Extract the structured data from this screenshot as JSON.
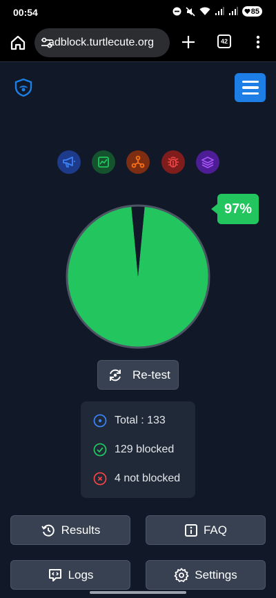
{
  "status_bar": {
    "time": "00:54",
    "battery": "85"
  },
  "browser": {
    "url": "adblock.turtlecute.org",
    "tab_count": "42"
  },
  "categories": [
    {
      "icon": "megaphone-icon",
      "bg": "#1e3a8a",
      "fg": "#3b82f6"
    },
    {
      "icon": "chart-icon",
      "bg": "#14532d",
      "fg": "#22c55e"
    },
    {
      "icon": "network-icon",
      "bg": "#7c2d12",
      "fg": "#f97316"
    },
    {
      "icon": "bug-icon",
      "bg": "#7f1d1d",
      "fg": "#ef4444"
    },
    {
      "icon": "layers-icon",
      "bg": "#4c1d95",
      "fg": "#a855f7"
    }
  ],
  "chart_data": {
    "type": "pie",
    "labels": [
      "blocked",
      "not blocked"
    ],
    "values": [
      129,
      4
    ],
    "colors": [
      "#22c55e",
      "#111827"
    ],
    "percent_label": "97%"
  },
  "retest": {
    "label": "Re-test"
  },
  "summary": {
    "total": "Total : 133",
    "blocked": "129 blocked",
    "not_blocked": "4 not blocked"
  },
  "buttons": {
    "results": "Results",
    "faq": "FAQ",
    "logs": "Logs",
    "settings": "Settings"
  }
}
